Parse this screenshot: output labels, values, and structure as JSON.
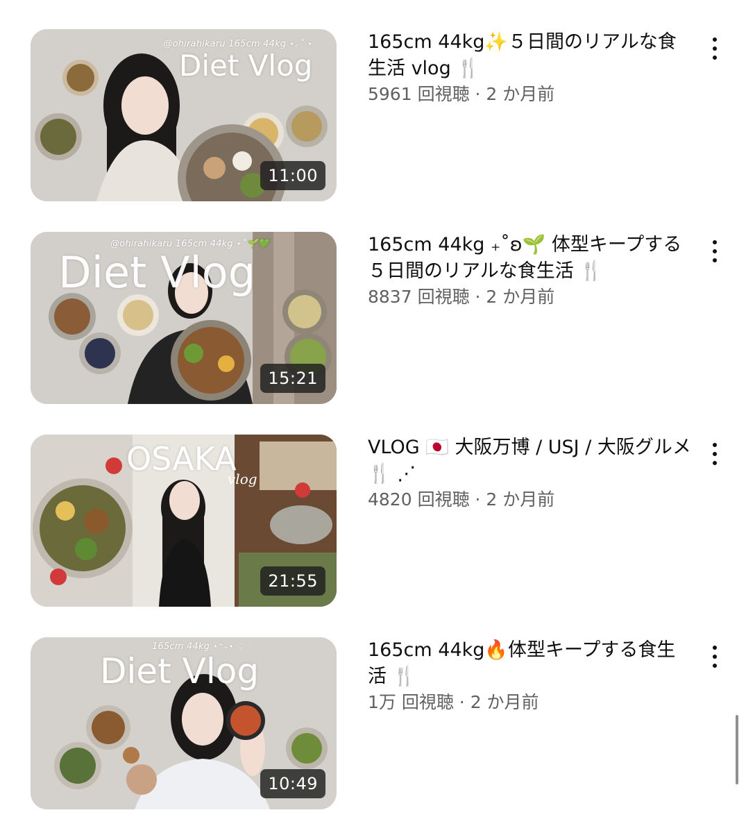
{
  "videos": [
    {
      "thumb_handle": "@ohirahikaru   165cm 44kg ⋆｡˚ ⋆",
      "thumb_title": "Diet Vlog",
      "thumb_sub": "",
      "duration": "11:00",
      "title": "165cm 44kg✨５日間のリアルな食生活 vlog 🍴",
      "stats": "5961 回視聴 · 2 か月前"
    },
    {
      "thumb_handle": "@ohirahikaru   165cm 44kg ⋆˚🌱💚",
      "thumb_title": "Diet Vlog",
      "thumb_sub": "",
      "duration": "15:21",
      "title": "165cm 44kg ₊˚ʚ🌱 体型キープする５日間のリアルな食生活 🍴",
      "stats": "8837 回視聴 · 2 か月前"
    },
    {
      "thumb_handle": "",
      "thumb_title": "OSAKA",
      "thumb_sub": "vlog",
      "duration": "21:55",
      "title": "VLOG 🇯🇵 大阪万博 / USJ / 大阪グルメ 🍴 ⋰",
      "stats": "4820 回視聴 · 2 か月前"
    },
    {
      "thumb_handle": "165cm 44kg ⋆⁺₊⋆ ♡",
      "thumb_title": "Diet Vlog",
      "thumb_sub": "",
      "duration": "10:49",
      "title": "165cm 44kg🔥体型キープする食生活 🍴",
      "stats": "1万 回視聴 · 2 か月前"
    }
  ],
  "more_icon": "vertical-ellipsis-icon"
}
